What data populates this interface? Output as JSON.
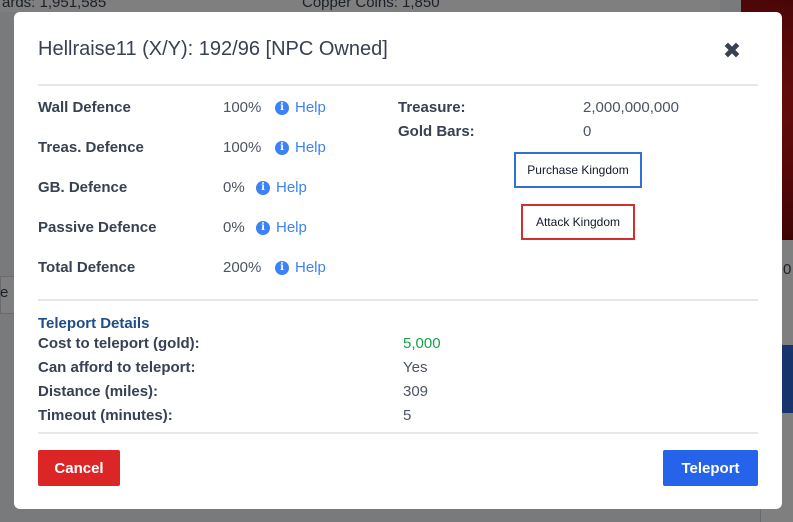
{
  "background": {
    "top_left_text": "ards: 1,951,585",
    "top_mid_text": "Copper Coins: 1,850",
    "right_zero": "0",
    "left_e": "e"
  },
  "modal": {
    "title": "Hellraise11 (X/Y): 192/96 [NPC Owned]",
    "close_glyph": "✖",
    "defences": [
      {
        "label": "Wall Defence",
        "value": "100%",
        "help": "Help"
      },
      {
        "label": "Treas. Defence",
        "value": "100%",
        "help": "Help"
      },
      {
        "label": "GB. Defence",
        "value": "0%",
        "help": "Help"
      },
      {
        "label": "Passive Defence",
        "value": "0%",
        "help": "Help"
      },
      {
        "label": "Total Defence",
        "value": "200%",
        "help": "Help"
      }
    ],
    "info_glyph": "i",
    "treasure": {
      "label": "Treasure:",
      "value": "2,000,000,000"
    },
    "gold_bars": {
      "label": "Gold Bars:",
      "value": "0"
    },
    "purchase_label": "Purchase Kingdom",
    "attack_label": "Attack Kingdom",
    "teleport": {
      "title": "Teleport Details",
      "rows": [
        {
          "label": "Cost to teleport (gold):",
          "value": "5,000"
        },
        {
          "label": "Can afford to teleport:",
          "value": "Yes"
        },
        {
          "label": "Distance (miles):",
          "value": "309"
        },
        {
          "label": "Timeout (minutes):",
          "value": "5"
        }
      ]
    },
    "cancel_label": "Cancel",
    "teleport_label": "Teleport"
  },
  "colors": {
    "help_blue": "#3b82f6",
    "cost_green": "#16a34a",
    "cancel_red": "#dc2626",
    "teleport_blue": "#2563eb",
    "section_title_blue": "#1e4e87"
  }
}
